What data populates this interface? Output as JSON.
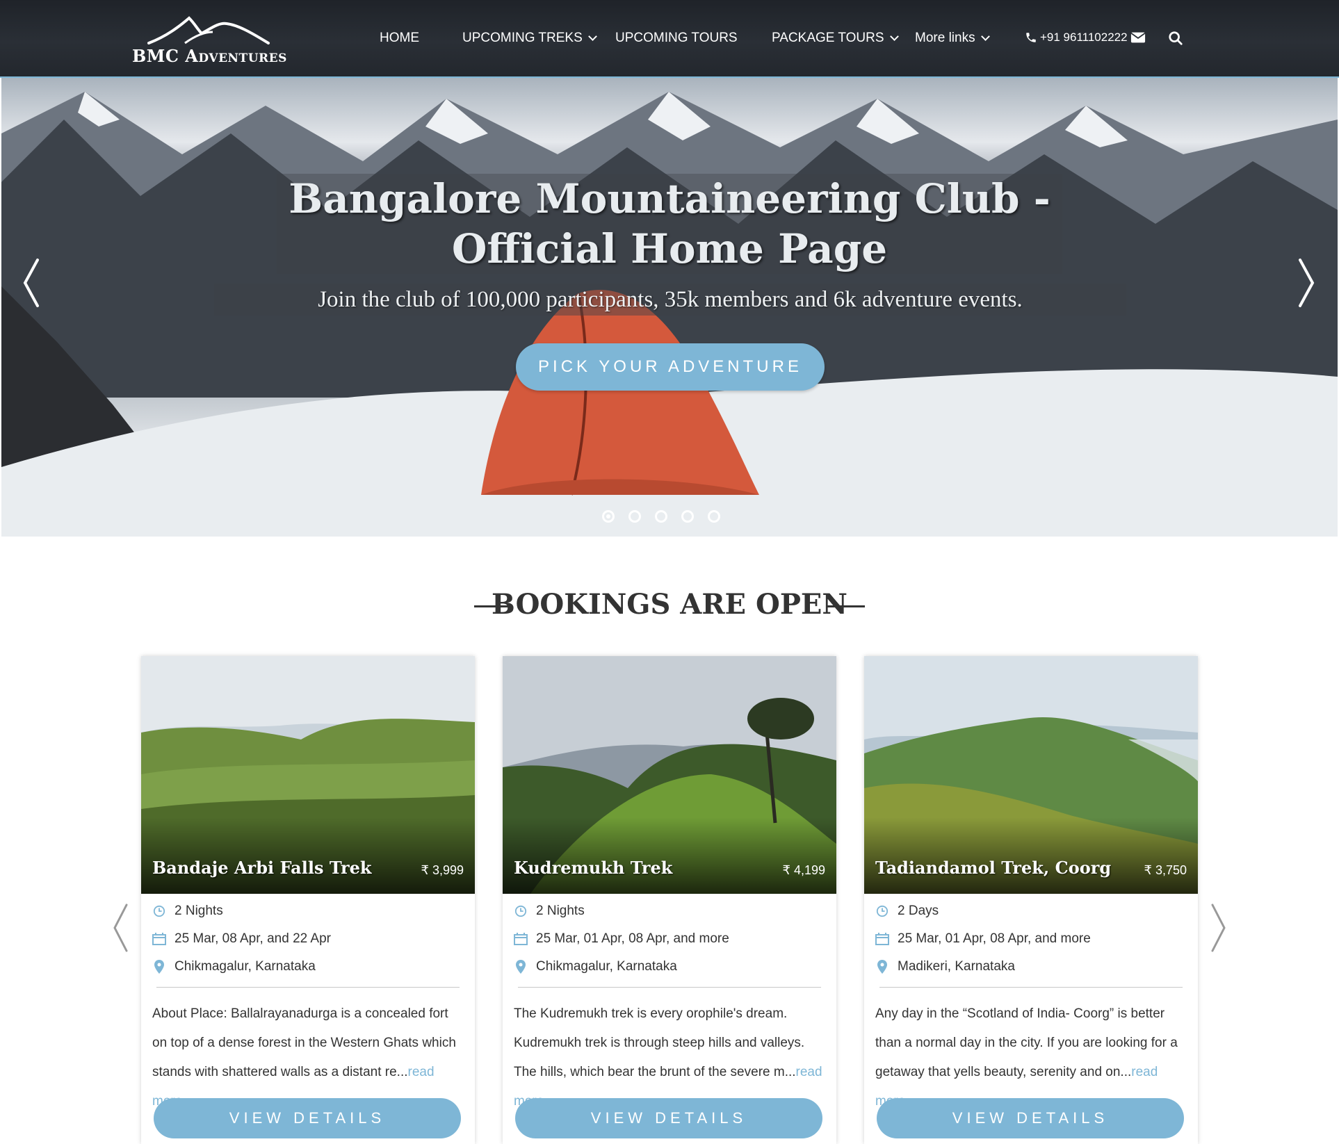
{
  "header": {
    "logo_text": "BMC Adventures",
    "nav": [
      {
        "label": "HOME"
      },
      {
        "label": "UPCOMING TREKS"
      },
      {
        "label": "UPCOMING TOURS"
      },
      {
        "label": "PACKAGE TOURS"
      },
      {
        "label": "More links"
      }
    ],
    "phone": "+91 9611102222",
    "icons": [
      "phone-icon",
      "envelope-icon",
      "search-icon"
    ]
  },
  "hero": {
    "title": "Bangalore Mountaineering Club - Official Home Page",
    "subtitle": "Join the club of 100,000 participants, 35k members and 6k adventure events.",
    "cta": "PICK YOUR ADVENTURE",
    "slides": 5,
    "active_slide": 1
  },
  "bookings": {
    "heading": "BOOKINGS ARE OPEN",
    "cards": [
      {
        "title": "Bandaje Arbi Falls Trek",
        "price": "₹ 3,999",
        "duration": "2 Nights",
        "dates": "25 Mar, 08 Apr, and 22 Apr",
        "location": "Chikmagalur, Karnataka",
        "description": "About Place: Ballalrayanadurga is a concealed fort on top of a dense forest in the Western Ghats which stands with shattered walls as a distant re...",
        "read_more": "read more",
        "button": "VIEW DETAILS"
      },
      {
        "title": "Kudremukh Trek",
        "price": "₹ 4,199",
        "duration": "2 Nights",
        "dates": "25 Mar, 01 Apr, 08 Apr, and more",
        "location": "Chikmagalur, Karnataka",
        "description": "The Kudremukh trek is every orophile's dream. Kudremukh trek is through steep hills and valleys. The hills, which bear the brunt of the severe m...",
        "read_more": "read more",
        "button": "VIEW DETAILS"
      },
      {
        "title": "Tadiandamol Trek, Coorg",
        "price": "₹ 3,750",
        "duration": "2 Days",
        "dates": "25 Mar, 01 Apr, 08 Apr, and more",
        "location": "Madikeri, Karnataka",
        "description": "Any day in the “Scotland of India- Coorg” is better than a normal day in the city. If you are looking for a getaway that yells beauty, serenity and on...",
        "read_more": "read more",
        "button": "VIEW DETAILS"
      }
    ]
  },
  "colors": {
    "accent": "#7eb6d6",
    "header_bg": "#23272d",
    "text": "#333333"
  }
}
